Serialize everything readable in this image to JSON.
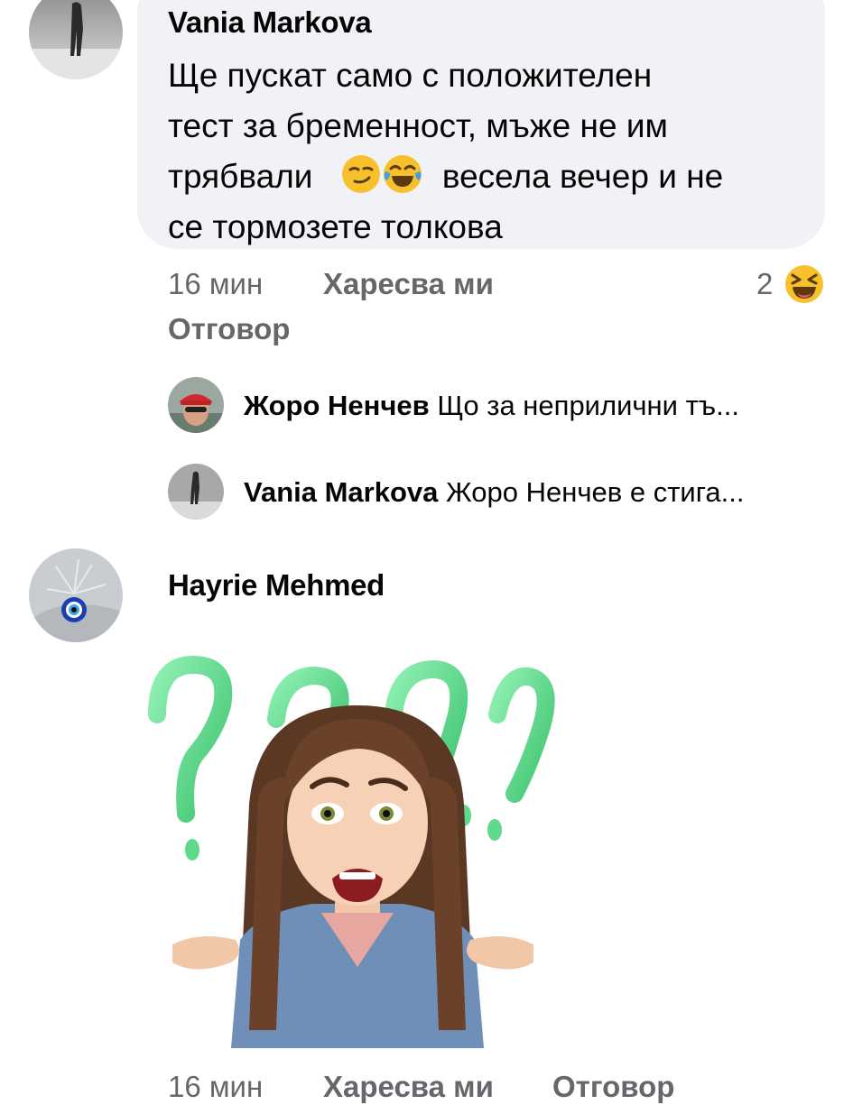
{
  "comment1": {
    "author": "Vania Markova",
    "text_part1": "Ще пускат само с положителен тест за бременност, мъже не им трябвали ",
    "text_line1": "Ще пускат само с положителен",
    "text_line2": "тест за бременност, мъже не им",
    "text_line3_start": "трябвали",
    "text_line3_end": "весела вечер и не",
    "text_line4": "се тормозете толкова",
    "inline_emojis": [
      "smirk-emoji",
      "tears-of-joy-emoji"
    ],
    "time": "16 мин",
    "like_label": "Харесва ми",
    "reply_label": "Отговор",
    "reaction_count": "2",
    "reaction_icon": "laughing-emoji"
  },
  "replies": [
    {
      "author": "Жоро Ненчев",
      "preview": "Що за неприлични тъ..."
    },
    {
      "author": "Vania Markova",
      "preview": "Жоро Ненчев  е стига..."
    }
  ],
  "comment2": {
    "author": "Hayrie Mehmed",
    "sticker": "confused-girl-question-marks-sticker",
    "time": "16 мин",
    "like_label": "Харесва ми",
    "reply_label": "Отговор"
  },
  "colors": {
    "bubble": "#f0f2f5",
    "meta_text": "#65676b",
    "text": "#050505",
    "question_mark_green": "#5fd98a"
  }
}
